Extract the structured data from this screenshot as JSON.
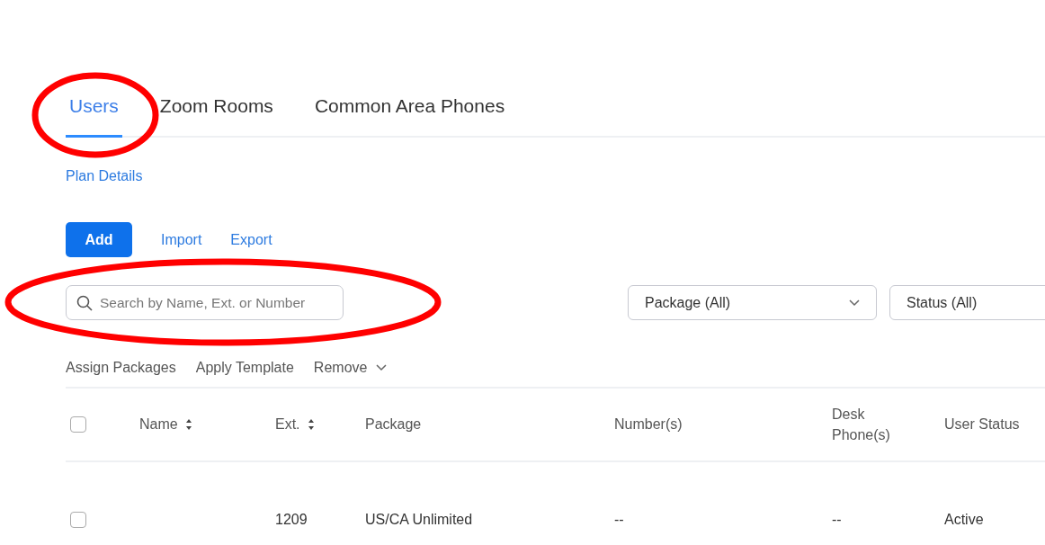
{
  "tabs": [
    {
      "label": "Users",
      "selected": true,
      "circled": true
    },
    {
      "label": "Zoom Rooms",
      "selected": false,
      "circled": false
    },
    {
      "label": "Common Area Phones",
      "selected": false,
      "circled": false
    }
  ],
  "plan_link": "Plan Details",
  "actions": {
    "add": "Add",
    "links": [
      "Import",
      "Export"
    ]
  },
  "search": {
    "placeholder": "Search by Name, Ext. or Number",
    "circled": true
  },
  "filters": [
    "Package (All)",
    "Status (All)"
  ],
  "bulk_actions": [
    {
      "label": "Assign Packages",
      "dropdown": false
    },
    {
      "label": "Apply Template",
      "dropdown": false
    },
    {
      "label": "Remove",
      "dropdown": true
    }
  ],
  "table": {
    "columns": [
      {
        "label": "Name",
        "sortable": true
      },
      {
        "label": "Ext.",
        "sortable": true
      },
      {
        "label": "Package",
        "sortable": false
      },
      {
        "label": "Number(s)",
        "sortable": false
      },
      {
        "label": "Desk\nPhone(s)",
        "sortable": false
      },
      {
        "label": "User Status",
        "sortable": false
      }
    ],
    "header_checked": false,
    "rows": [
      {
        "checked": false,
        "cells": [
          "",
          "1209",
          "US/CA Unlimited",
          "--",
          "--",
          "Active"
        ]
      }
    ]
  }
}
